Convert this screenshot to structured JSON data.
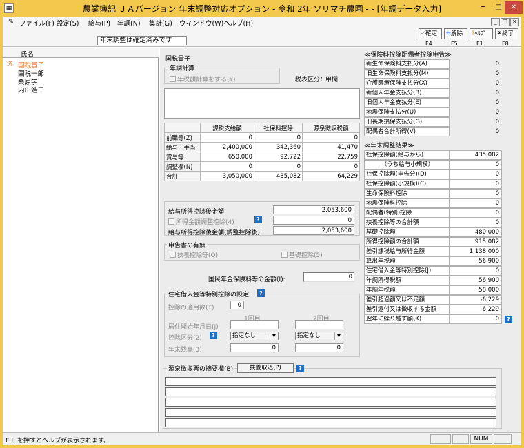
{
  "window": {
    "title": "農業簿記 ＪＡバージョン 年末調整対応オプション - 令和 2年 ソリマチ農園 - - [年調データ入力]",
    "icon": "app-icon"
  },
  "menu": [
    "ファイル(F)",
    "設定(S)",
    "給与(P)",
    "年調(N)",
    "集計(G)",
    "ウィンドウ(W)",
    "ヘルプ(H)"
  ],
  "toolbar": {
    "banner": "年末調整は確定済みです",
    "buttons": [
      {
        "label": "確定",
        "key": "F4",
        "icon": "confirm-icon"
      },
      {
        "label": "解除",
        "key": "F5",
        "icon": "release-icon"
      },
      {
        "label": "ﾍﾙﾌﾟ",
        "key": "F1",
        "icon": "help-icon"
      },
      {
        "label": "終了",
        "key": "F8",
        "icon": "exit-icon"
      }
    ]
  },
  "left": {
    "header": "氏名",
    "mark": "済",
    "employees": [
      "国税貴子",
      "国税一郎",
      "桑原学",
      "内山浩三"
    ]
  },
  "form": {
    "name": "国税貴子",
    "nencho_group": "年調計算",
    "nencho_check": "年税額計算をする(Y)",
    "tax_class_label": "税表区分：",
    "tax_class_value": "甲欄",
    "grid_headers": [
      "課税支給額",
      "社保料控除",
      "源泉徴収税額"
    ],
    "grid_rows": [
      {
        "label": "前職等(Z)",
        "values": [
          "0",
          "0",
          "0"
        ]
      },
      {
        "label": "給与・手当",
        "values": [
          "2,400,000",
          "342,360",
          "41,470"
        ]
      },
      {
        "label": "賞与等",
        "values": [
          "650,000",
          "92,722",
          "22,759"
        ]
      },
      {
        "label": "調整欄(N)",
        "values": [
          "0",
          "0",
          "0"
        ]
      },
      {
        "label": "合計",
        "values": [
          "3,050,000",
          "435,082",
          "64,229"
        ]
      }
    ],
    "deduction_amount_label": "給与所得控除後金額:",
    "deduction_amount": "2,053,600",
    "adjust_check": "所得金額調整控除(4)",
    "adjust_value": "0",
    "after_adjust_label": "給与所得控除後金額(調整控除後):",
    "after_adjust_value": "2,053,600",
    "declaration_group": "申告書の有無",
    "fuyo_check": "扶養控除等(Q)",
    "kiso_check": "基礎控除(5)",
    "pension_label": "国民年金保険料等の金額(I):",
    "pension_value": "0",
    "housing_group": "住宅借入金等特別控除の設定",
    "housing_count_label": "控除の適用数(T)",
    "housing_count": "0",
    "first": "1回目",
    "second": "2回目",
    "move_in_label": "居住開始年月日(J)",
    "class_label": "控除区分(2)",
    "class_value1": "指定なし",
    "class_value2": "指定なし",
    "balance_label": "年末残高(3)",
    "balance1": "0",
    "balance2": "0",
    "memo_label": "源泉徴収票の摘要欄(B)",
    "memo_button": "扶養取込(P)"
  },
  "insurance": {
    "title": "≪保険料控除配偶者控除申告≫",
    "rows": [
      {
        "label": "新生命保険料支払分(A)",
        "value": "0"
      },
      {
        "label": "旧生命保険料支払分(M)",
        "value": "0"
      },
      {
        "label": "介護医療保険支払分(X)",
        "value": "0"
      },
      {
        "label": "新個人年金支払分(B)",
        "value": "0"
      },
      {
        "label": "旧個人年金支払分(E)",
        "value": "0"
      },
      {
        "label": "地震保険支払分(U)",
        "value": "0"
      },
      {
        "label": "旧長期損保支払分(G)",
        "value": "0"
      },
      {
        "label": "配偶者合計所得(V)",
        "value": "0"
      }
    ]
  },
  "result": {
    "title": "≪年末調整結果≫",
    "rows": [
      {
        "label": "社保控除額(給与から)",
        "value": "435,082"
      },
      {
        "label": "（うち給与小規模）",
        "value": "0"
      },
      {
        "label": "社保控除額(申告分)(D)",
        "value": "0"
      },
      {
        "label": "社保控除額(小規模)(C)",
        "value": "0"
      },
      {
        "label": "生命保険料控除",
        "value": "0"
      },
      {
        "label": "地震保険料控除",
        "value": "0"
      },
      {
        "label": "配偶者(特別)控除",
        "value": "0"
      },
      {
        "label": "扶養控除等の合計額",
        "value": "0"
      },
      {
        "label": "基礎控除額",
        "value": "480,000"
      },
      {
        "label": "所得控除額の合計額",
        "value": "915,082"
      },
      {
        "label": "差引課税給与所得金額",
        "value": "1,138,000"
      },
      {
        "label": "算出年税額",
        "value": "56,900"
      },
      {
        "label": "住宅借入金等特別控除(J)",
        "value": "0"
      },
      {
        "label": "年調所得税額",
        "value": "56,900"
      },
      {
        "label": "年調年税額",
        "value": "58,000"
      },
      {
        "label": "差引超過額又は不足額",
        "value": "-6,229"
      },
      {
        "label": "差引還付又は徴収する金額",
        "value": "-6,229"
      },
      {
        "label": "翌年に繰り越す額(K)",
        "value": "0"
      }
    ]
  },
  "status": {
    "text": "F１ を押すとヘルプが表示されます。",
    "num": "NUM"
  }
}
